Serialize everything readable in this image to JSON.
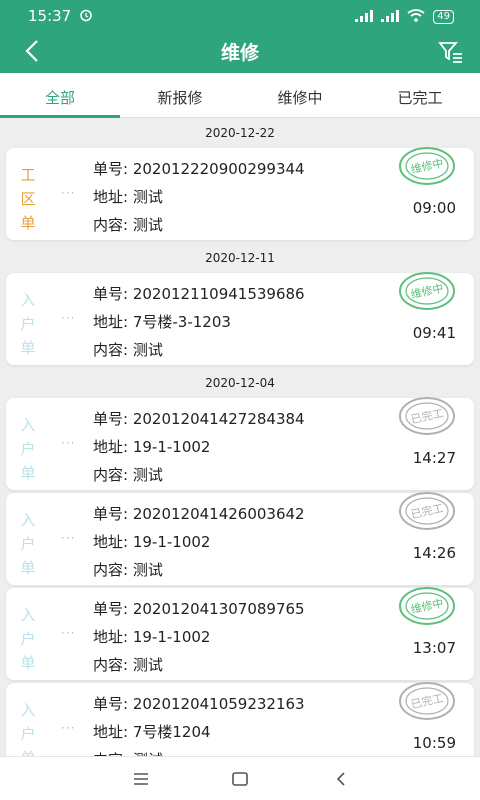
{
  "status_bar": {
    "time": "15:37",
    "battery": "49"
  },
  "header": {
    "title": "维修"
  },
  "tabs": [
    {
      "label": "全部"
    },
    {
      "label": "新报修"
    },
    {
      "label": "维修中"
    },
    {
      "label": "已完工"
    }
  ],
  "colors": {
    "brand": "#2ea57d",
    "work_order": "#e6a23c",
    "home_order": "#b8e4ea",
    "stamp_green": "#5cbf7a",
    "stamp_gray": "#b0b0b0"
  },
  "groups": [
    {
      "date": "2020-12-22",
      "items": [
        {
          "type": "工区单",
          "type_style": "work",
          "number_label": "单号: 202012220900299344",
          "address_label": "地址: 测试",
          "content_label": "内容: 测试",
          "time": "09:00",
          "stamp": "维修中"
        }
      ]
    },
    {
      "date": "2020-12-11",
      "items": [
        {
          "type": "入户单",
          "type_style": "home",
          "number_label": "单号: 202012110941539686",
          "address_label": "地址: 7号楼-3-1203",
          "content_label": "内容: 测试",
          "time": "09:41",
          "stamp": "维修中"
        }
      ]
    },
    {
      "date": "2020-12-04",
      "items": [
        {
          "type": "入户单",
          "type_style": "home",
          "number_label": "单号: 202012041427284384",
          "address_label": "地址: 19-1-1002",
          "content_label": "内容: 测试",
          "time": "14:27",
          "stamp": "已完工"
        },
        {
          "type": "入户单",
          "type_style": "home",
          "number_label": "单号: 202012041426003642",
          "address_label": "地址: 19-1-1002",
          "content_label": "内容: 测试",
          "time": "14:26",
          "stamp": "已完工"
        },
        {
          "type": "入户单",
          "type_style": "home",
          "number_label": "单号: 202012041307089765",
          "address_label": "地址: 19-1-1002",
          "content_label": "内容: 测试",
          "time": "13:07",
          "stamp": "维修中"
        },
        {
          "type": "入户单",
          "type_style": "home",
          "number_label": "单号: 202012041059232163",
          "address_label": "地址: 7号楼1204",
          "content_label": "内容: 测试",
          "time": "10:59",
          "stamp": "已完工"
        }
      ]
    }
  ]
}
